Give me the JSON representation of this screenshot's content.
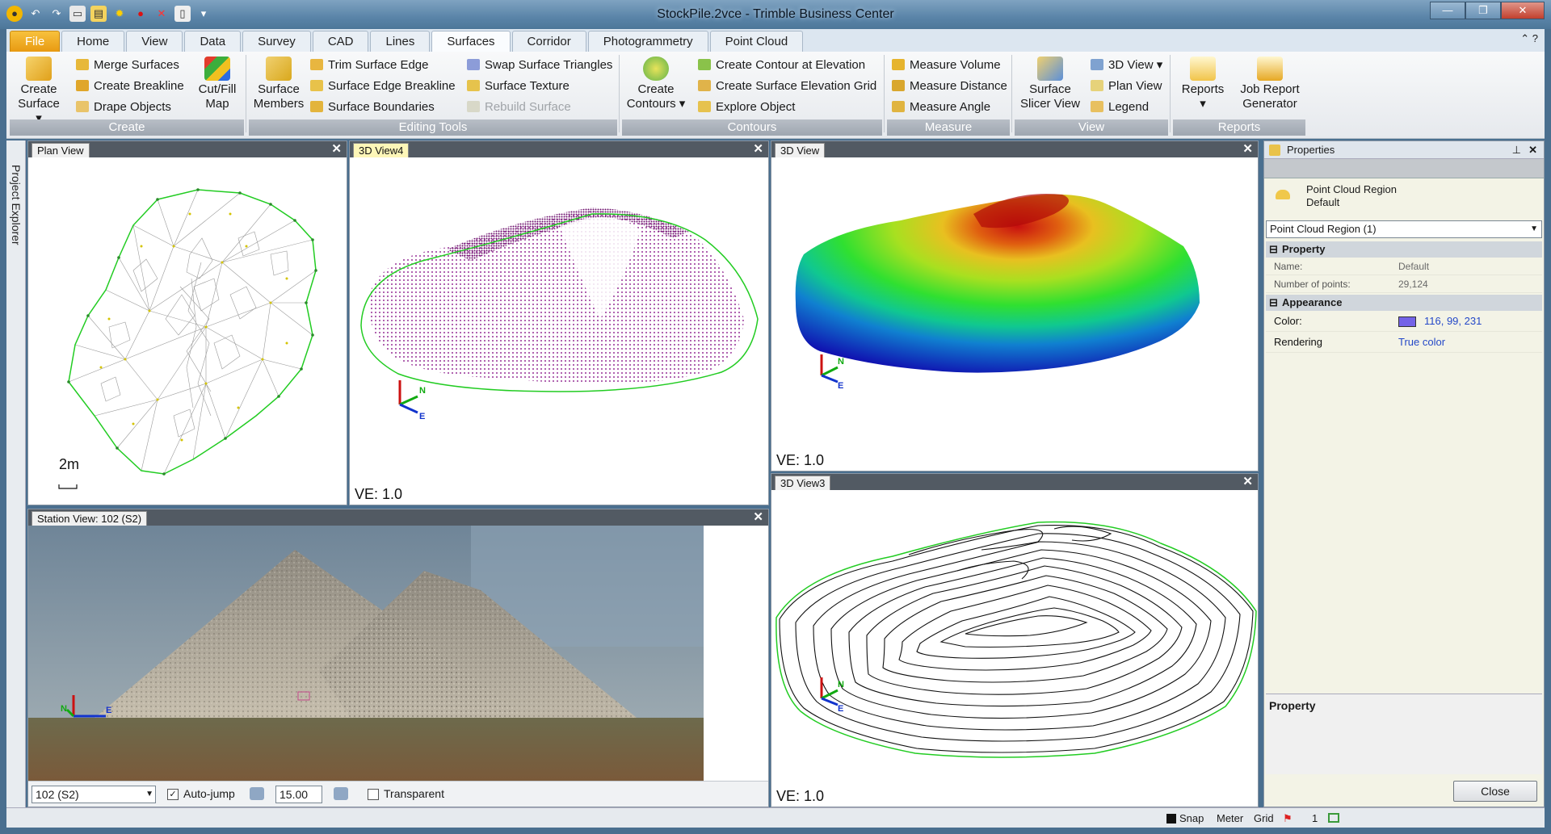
{
  "window": {
    "title": "StockPile.2vce - Trimble Business Center"
  },
  "tabs": [
    "File",
    "Home",
    "View",
    "Data",
    "Survey",
    "CAD",
    "Lines",
    "Surfaces",
    "Corridor",
    "Photogrammetry",
    "Point Cloud"
  ],
  "active_tab": "Surfaces",
  "ribbon": {
    "create": {
      "label": "Create",
      "create_surface": [
        "Create",
        "Surface"
      ],
      "merge_surfaces": "Merge Surfaces",
      "create_breakline": "Create Breakline",
      "drape_objects": "Drape Objects",
      "cut_fill_map": [
        "Cut/Fill",
        "Map"
      ]
    },
    "editing": {
      "label": "Editing Tools",
      "surface_members": [
        "Surface",
        "Members"
      ],
      "trim_surface_edge": "Trim Surface Edge",
      "surface_edge_breakline": "Surface Edge Breakline",
      "surface_boundaries": "Surface Boundaries",
      "swap_surface_triangles": "Swap Surface Triangles",
      "surface_texture": "Surface Texture",
      "rebuild_surface": "Rebuild Surface"
    },
    "contours": {
      "label": "Contours",
      "create_contours": [
        "Create",
        "Contours"
      ],
      "create_contour_at_elevation": "Create Contour at Elevation",
      "create_surface_elevation_grid": "Create Surface Elevation Grid",
      "explore_object": "Explore Object"
    },
    "measure": {
      "label": "Measure",
      "measure_volume": "Measure Volume",
      "measure_distance": "Measure Distance",
      "measure_angle": "Measure Angle"
    },
    "view": {
      "label": "View",
      "surface_slicer_view": [
        "Surface",
        "Slicer View"
      ],
      "view_3d": "3D View",
      "plan_view": "Plan View",
      "legend": "Legend"
    },
    "reports": {
      "label": "Reports",
      "reports_btn": "Reports",
      "job_report_generator": [
        "Job Report",
        "Generator"
      ]
    }
  },
  "side_strip": {
    "label": "Project Explorer"
  },
  "panels": {
    "plan_view": {
      "title": "Plan View",
      "scale": "2m"
    },
    "view3d4": {
      "title": "3D View4",
      "ve": "VE: 1.0"
    },
    "view3d": {
      "title": "3D View",
      "ve": "VE: 1.0"
    },
    "view3d3": {
      "title": "3D View3",
      "ve": "VE: 1.0"
    },
    "station": {
      "title": "Station View: 102 (S2)",
      "station_select": "102 (S2)",
      "auto_jump": "Auto-jump",
      "auto_jump_checked": true,
      "zoom_value": "15.00",
      "transparent": "Transparent",
      "transparent_checked": false
    }
  },
  "axis_labels": {
    "north": "N",
    "east": "E"
  },
  "properties": {
    "title": "Properties",
    "object_type": "Point Cloud Region",
    "object_name": "Default",
    "selector": "Point Cloud Region (1)",
    "section_property": "Property",
    "name_label": "Name:",
    "name_value": "Default",
    "points_label": "Number of points:",
    "points_value": "29,124",
    "section_appearance": "Appearance",
    "color_label": "Color:",
    "color_value": "116, 99, 231",
    "color_swatch": "#7463e7",
    "rendering_label": "Rendering",
    "rendering_value": "True color",
    "desc_title": "Property",
    "close_button": "Close"
  },
  "statusbar": {
    "snap": "Snap",
    "units": "Meter",
    "grid": "Grid",
    "count": "1"
  }
}
